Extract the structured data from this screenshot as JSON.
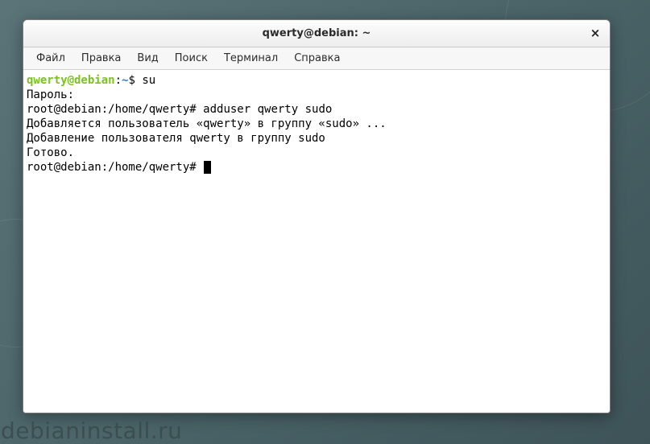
{
  "titlebar": {
    "title": "qwerty@debian: ~",
    "close_glyph": "×"
  },
  "menubar": {
    "items": [
      {
        "label": "Файл"
      },
      {
        "label": "Правка"
      },
      {
        "label": "Вид"
      },
      {
        "label": "Поиск"
      },
      {
        "label": "Терминал"
      },
      {
        "label": "Справка"
      }
    ]
  },
  "terminal": {
    "prompt1_user": "qwerty@debian",
    "prompt1_sep": ":",
    "prompt1_path": "~",
    "prompt1_sym": "$ ",
    "cmd1": "su",
    "line_password": "Пароль:",
    "prompt2": "root@debian:/home/qwerty# ",
    "cmd2": "adduser qwerty sudo",
    "out1": "Добавляется пользователь «qwerty» в группу «sudo» ...",
    "out2": "Добавление пользователя qwerty в группу sudo",
    "out3": "Готово.",
    "prompt3": "root@debian:/home/qwerty# "
  },
  "watermark": "debianinstall.ru"
}
